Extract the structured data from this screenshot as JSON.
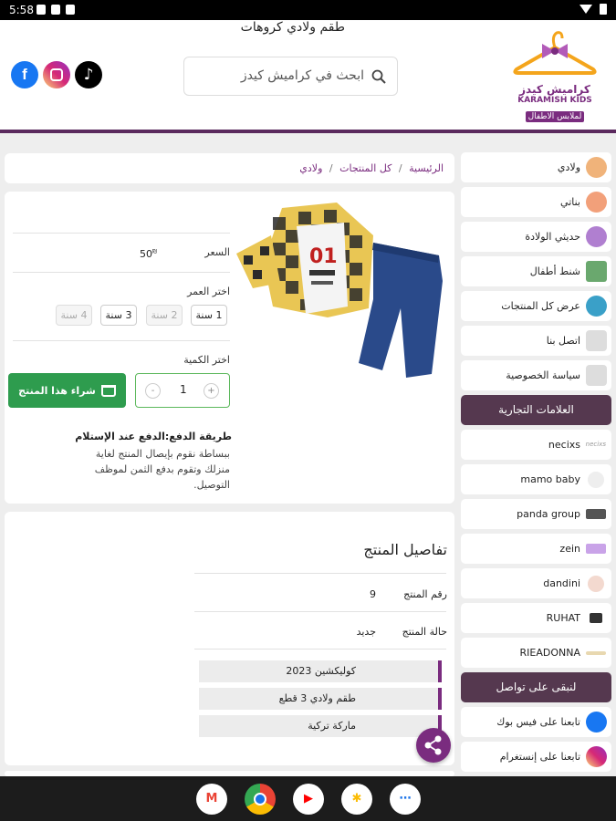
{
  "status_bar": {
    "time": "5:58"
  },
  "header": {
    "logo": {
      "line1": "كراميش كيدز",
      "line2": "KARAMISH KIDS",
      "line3": "لملابس الاطفال"
    },
    "search_placeholder": "ابحث في كراميش كيدز",
    "social": {
      "facebook": "f",
      "tiktok": "♪"
    }
  },
  "sidebar": {
    "categories": [
      {
        "label": "ولادي",
        "icon": "boy-icon",
        "color": "#f0b37a"
      },
      {
        "label": "بناتي",
        "icon": "girl-icon",
        "color": "#f2a07a"
      },
      {
        "label": "حديثي الولادة",
        "icon": "baby-bottle-icon",
        "color": "#b07fd0"
      },
      {
        "label": "شنط أطفال",
        "icon": "bag-icon",
        "color": "#6aa86e"
      },
      {
        "label": "عرض كل المنتجات",
        "icon": "eye-icon",
        "color": "#3aa0c8"
      },
      {
        "label": "اتصل بنا",
        "icon": "link-icon",
        "color": "#bbbbbb"
      },
      {
        "label": "سياسة الخصوصية",
        "icon": "link-icon",
        "color": "#bbbbbb"
      }
    ],
    "brands_heading": "العلامات التجارية",
    "brands": [
      {
        "label": "necixs",
        "logo": "necixs-logo"
      },
      {
        "label": "mamo baby",
        "logo": "mamo-baby-logo"
      },
      {
        "label": "panda group",
        "logo": "panda-group-logo"
      },
      {
        "label": "zein",
        "logo": "zein-logo"
      },
      {
        "label": "dandini",
        "logo": "dandini-logo"
      },
      {
        "label": "RUHAT",
        "logo": "ruhat-logo"
      },
      {
        "label": "RIEADONNA",
        "logo": "rieadonna-logo"
      }
    ],
    "contact_heading": "لنبقى على تواصل",
    "contact": [
      {
        "label": "تابعنا على فيس بوك",
        "icon": "facebook-icon"
      },
      {
        "label": "تابعنا على إنستغرام",
        "icon": "instagram-icon"
      }
    ]
  },
  "breadcrumb": {
    "home": "الرئيسية",
    "all": "كل المنتجات",
    "current": "ولادي",
    "sep": "/"
  },
  "product": {
    "title": "طقم ولادي كروهات",
    "price_label": "السعر",
    "price_value": "50",
    "price_currency": "₪",
    "age_label": "اختر العمر",
    "ages": [
      {
        "label": "1 سنة",
        "available": true
      },
      {
        "label": "2 سنة",
        "available": false
      },
      {
        "label": "3 سنة",
        "available": true
      },
      {
        "label": "4 سنة",
        "available": false
      }
    ],
    "qty_label": "اختر الكمية",
    "qty_value": "1",
    "qty_minus": "-",
    "qty_plus": "+",
    "buy_label": "شراء هذا المنتج",
    "payment_title": "طريقة الدفع:الدفع عند الإستلام",
    "payment_text": "ببساطة نقوم بإيصال المنتج لغاية منزلك وتقوم بدفع الثمن لموظف التوصيل."
  },
  "details": {
    "title": "تفاصيل المنتج",
    "rows": [
      {
        "label": "رقم المنتج",
        "value": "9"
      },
      {
        "label": "حالة المنتج",
        "value": "جديد"
      }
    ],
    "tags": [
      "كوليكشين 2023",
      "طقم ولادي 3 قطع",
      "ماركة تركية"
    ]
  },
  "navbar": {
    "apps": [
      {
        "name": "gmail-icon",
        "glyph": "M",
        "color": "#ea4335"
      },
      {
        "name": "chrome-icon",
        "glyph": "●",
        "color": "#1a73e8"
      },
      {
        "name": "youtube-icon",
        "glyph": "▶",
        "color": "#ff0000"
      },
      {
        "name": "photos-icon",
        "glyph": "✱",
        "color": "#fbbc04"
      },
      {
        "name": "app-drawer-icon",
        "glyph": "⋯",
        "color": "#1a73e8"
      }
    ]
  }
}
